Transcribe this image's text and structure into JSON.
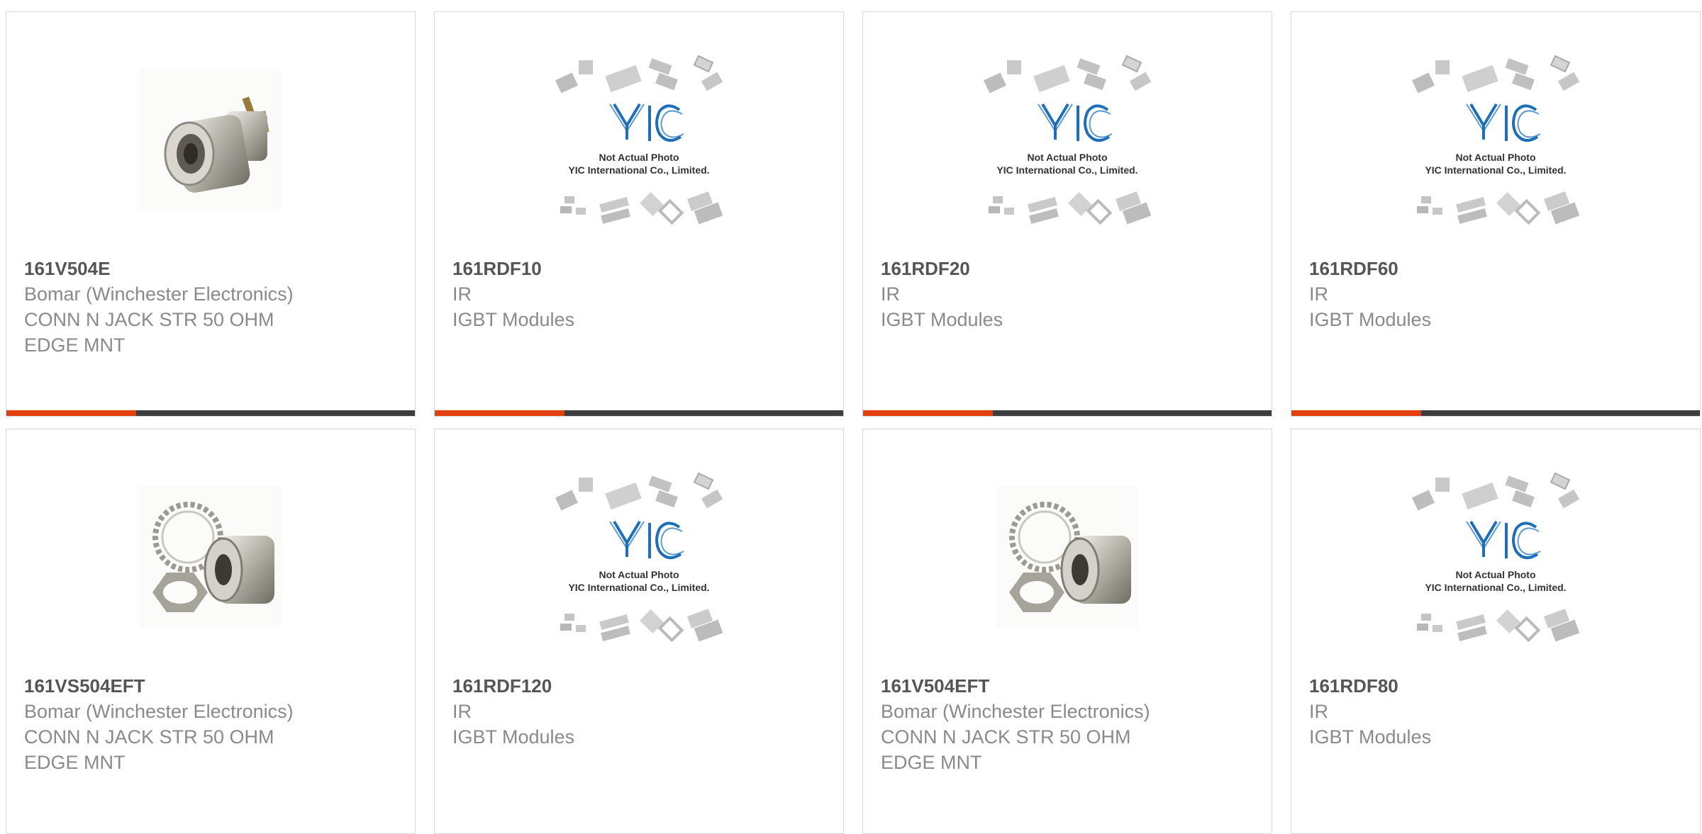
{
  "colors": {
    "accent": "#e2400f",
    "bar": "#3d3d3d",
    "yic_blue": "#1f6fb8"
  },
  "placeholder": {
    "line1": "Not Actual Photo",
    "line2": "YIC International Co., Limited.",
    "logo": "YIC"
  },
  "products": [
    {
      "part": "161V504E",
      "manufacturer": "Bomar (Winchester Electronics)",
      "desc1": "CONN N JACK STR 50 OHM",
      "desc2": "EDGE MNT",
      "image": "connector-jack-icon"
    },
    {
      "part": "161RDF10",
      "manufacturer": "IR",
      "desc1": "IGBT Modules",
      "desc2": "",
      "image": "placeholder-photo"
    },
    {
      "part": "161RDF20",
      "manufacturer": "IR",
      "desc1": "IGBT Modules",
      "desc2": "",
      "image": "placeholder-photo"
    },
    {
      "part": "161RDF60",
      "manufacturer": "IR",
      "desc1": "IGBT Modules",
      "desc2": "",
      "image": "placeholder-photo"
    },
    {
      "part": "161VS504EFT",
      "manufacturer": "Bomar (Winchester Electronics)",
      "desc1": "CONN N JACK STR 50 OHM",
      "desc2": "EDGE MNT",
      "image": "connector-kit-icon"
    },
    {
      "part": "161RDF120",
      "manufacturer": "IR",
      "desc1": "IGBT Modules",
      "desc2": "",
      "image": "placeholder-photo"
    },
    {
      "part": "161V504EFT",
      "manufacturer": "Bomar (Winchester Electronics)",
      "desc1": "CONN N JACK STR 50 OHM",
      "desc2": "EDGE MNT",
      "image": "connector-kit-icon"
    },
    {
      "part": "161RDF80",
      "manufacturer": "IR",
      "desc1": "IGBT Modules",
      "desc2": "",
      "image": "placeholder-photo"
    }
  ]
}
